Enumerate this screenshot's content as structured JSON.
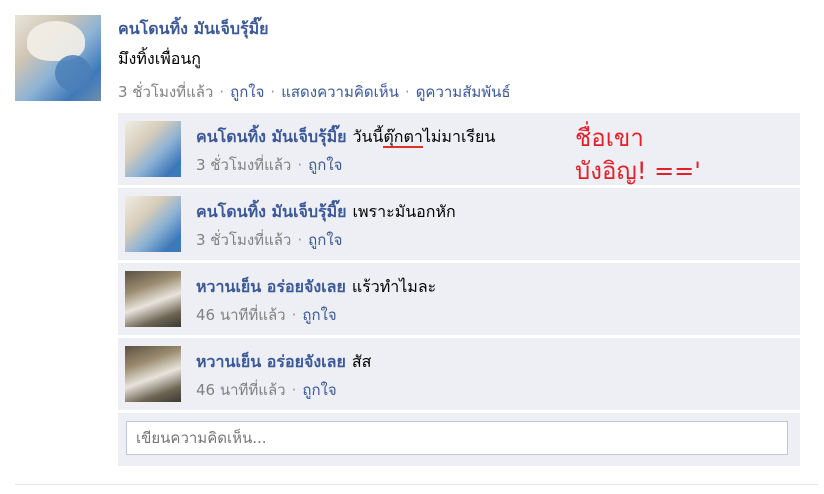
{
  "post": {
    "author": "คนโดนทิ้ง มันเจ็บรุ้มิ๊ย",
    "text": "มึงทิ้งเพื่อนกู",
    "time": "3 ชั่วโมงที่แล้ว",
    "like": "ถูกใจ",
    "comment": "แสดงความคิดเห็น",
    "view_relationship": "ดูความสัมพันธ์"
  },
  "comments": [
    {
      "author": "คนโดนทิ้ง มันเจ็บรุ้มิ๊ย",
      "text_before": "วันนี้",
      "text_underlined": "ตุ๊กตา",
      "text_after": "ไม่มาเรียน",
      "time": "3 ชั่วโมงที่แล้ว",
      "like": "ถูกใจ"
    },
    {
      "author": "คนโดนทิ้ง มันเจ็บรุ้มิ๊ย",
      "text": "เพราะมันอกหัก",
      "time": "3 ชั่วโมงที่แล้ว",
      "like": "ถูกใจ"
    },
    {
      "author": "หวานเย็น อร่อยจังเลย",
      "text": "แร้วทำไมละ",
      "time": "46 นาทีที่แล้ว",
      "like": "ถูกใจ"
    },
    {
      "author": "หวานเย็น อร่อยจังเลย",
      "text": "สัส",
      "time": "46 นาทีที่แล้ว",
      "like": "ถูกใจ"
    }
  ],
  "write_comment": {
    "placeholder": "เขียนความคิดเห็น..."
  },
  "annotation": {
    "line1": "ชื่อเขา",
    "line2": "บังอิญ! =='"
  },
  "colors": {
    "link": "#3b5998",
    "comment_bg": "#edeff4",
    "annotation": "#e0202a"
  }
}
